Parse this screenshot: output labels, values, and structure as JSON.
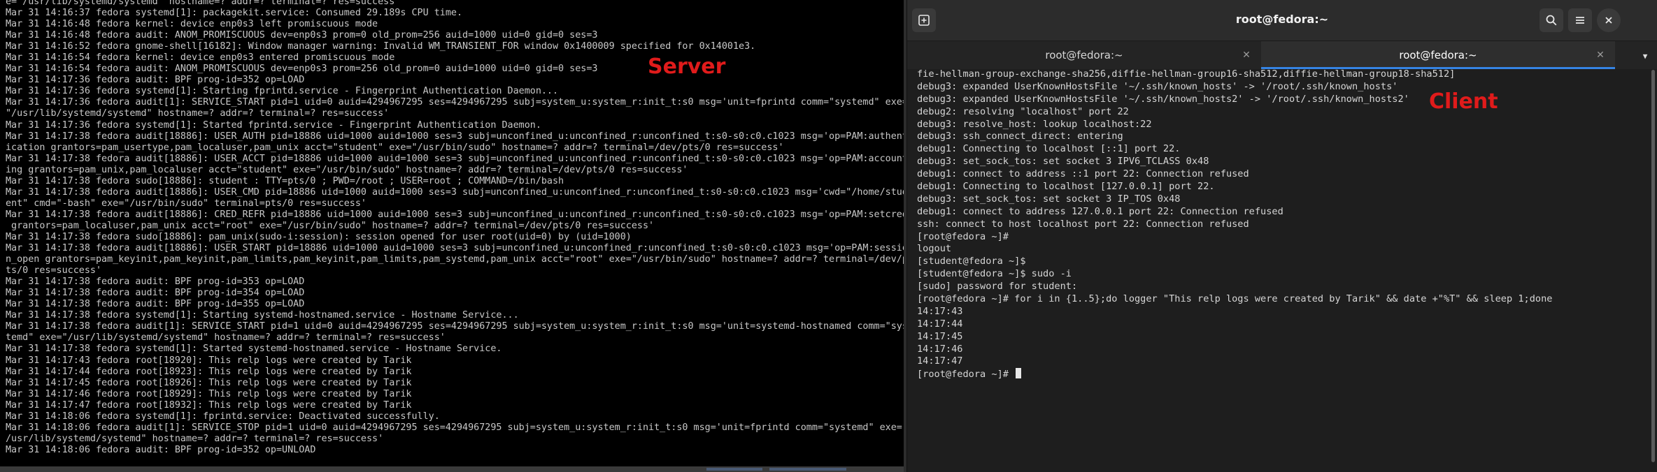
{
  "server": {
    "label": "Server",
    "log_lines": [
      "e=\"/usr/lib/systemd/systemd\" hostname=? addr=? terminal=? res=success'",
      "Mar 31 14:16:37 fedora systemd[1]: packagekit.service: Consumed 29.189s CPU time.",
      "Mar 31 14:16:48 fedora kernel: device enp0s3 left promiscuous mode",
      "Mar 31 14:16:48 fedora audit: ANOM_PROMISCUOUS dev=enp0s3 prom=0 old_prom=256 auid=1000 uid=0 gid=0 ses=3",
      "Mar 31 14:16:52 fedora gnome-shell[16182]: Window manager warning: Invalid WM_TRANSIENT_FOR window 0x1400009 specified for 0x14001e3.",
      "Mar 31 14:16:54 fedora kernel: device enp0s3 entered promiscuous mode",
      "Mar 31 14:16:54 fedora audit: ANOM_PROMISCUOUS dev=enp0s3 prom=256 old_prom=0 auid=1000 uid=0 gid=0 ses=3",
      "Mar 31 14:17:36 fedora audit: BPF prog-id=352 op=LOAD",
      "Mar 31 14:17:36 fedora systemd[1]: Starting fprintd.service - Fingerprint Authentication Daemon...",
      "Mar 31 14:17:36 fedora audit[1]: SERVICE_START pid=1 uid=0 auid=4294967295 ses=4294967295 subj=system_u:system_r:init_t:s0 msg='unit=fprintd comm=\"systemd\" exe=",
      "\"/usr/lib/systemd/systemd\" hostname=? addr=? terminal=? res=success'",
      "Mar 31 14:17:36 fedora systemd[1]: Started fprintd.service - Fingerprint Authentication Daemon.",
      "Mar 31 14:17:38 fedora audit[18886]: USER_AUTH pid=18886 uid=1000 auid=1000 ses=3 subj=unconfined_u:unconfined_r:unconfined_t:s0-s0:c0.c1023 msg='op=PAM:authent",
      "ication grantors=pam_usertype,pam_localuser,pam_unix acct=\"student\" exe=\"/usr/bin/sudo\" hostname=? addr=? terminal=/dev/pts/0 res=success'",
      "Mar 31 14:17:38 fedora audit[18886]: USER_ACCT pid=18886 uid=1000 auid=1000 ses=3 subj=unconfined_u:unconfined_r:unconfined_t:s0-s0:c0.c1023 msg='op=PAM:account",
      "ing grantors=pam_unix,pam_localuser acct=\"student\" exe=\"/usr/bin/sudo\" hostname=? addr=? terminal=/dev/pts/0 res=success'",
      "Mar 31 14:17:38 fedora sudo[18886]: student : TTY=pts/0 ; PWD=/root ; USER=root ; COMMAND=/bin/bash",
      "Mar 31 14:17:38 fedora audit[18886]: USER_CMD pid=18886 uid=1000 auid=1000 ses=3 subj=unconfined_u:unconfined_r:unconfined_t:s0-s0:c0.c1023 msg='cwd=\"/home/stud",
      "ent\" cmd=\"-bash\" exe=\"/usr/bin/sudo\" terminal=pts/0 res=success'",
      "Mar 31 14:17:38 fedora audit[18886]: CRED_REFR pid=18886 uid=1000 auid=1000 ses=3 subj=unconfined_u:unconfined_r:unconfined_t:s0-s0:c0.c1023 msg='op=PAM:setcred",
      " grantors=pam_localuser,pam_unix acct=\"root\" exe=\"/usr/bin/sudo\" hostname=? addr=? terminal=/dev/pts/0 res=success'",
      "Mar 31 14:17:38 fedora sudo[18886]: pam_unix(sudo-i:session): session opened for user root(uid=0) by (uid=1000)",
      "Mar 31 14:17:38 fedora audit[18886]: USER_START pid=18886 uid=1000 auid=1000 ses=3 subj=unconfined_u:unconfined_r:unconfined_t:s0-s0:c0.c1023 msg='op=PAM:sessio",
      "n_open grantors=pam_keyinit,pam_keyinit,pam_limits,pam_keyinit,pam_limits,pam_systemd,pam_unix acct=\"root\" exe=\"/usr/bin/sudo\" hostname=? addr=? terminal=/dev/p",
      "ts/0 res=success'",
      "Mar 31 14:17:38 fedora audit: BPF prog-id=353 op=LOAD",
      "Mar 31 14:17:38 fedora audit: BPF prog-id=354 op=LOAD",
      "Mar 31 14:17:38 fedora audit: BPF prog-id=355 op=LOAD",
      "Mar 31 14:17:38 fedora systemd[1]: Starting systemd-hostnamed.service - Hostname Service...",
      "Mar 31 14:17:38 fedora audit[1]: SERVICE_START pid=1 uid=0 auid=4294967295 ses=4294967295 subj=system_u:system_r:init_t:s0 msg='unit=systemd-hostnamed comm=\"sys",
      "temd\" exe=\"/usr/lib/systemd/systemd\" hostname=? addr=? terminal=? res=success'",
      "Mar 31 14:17:38 fedora systemd[1]: Started systemd-hostnamed.service - Hostname Service.",
      "Mar 31 14:17:43 fedora root[18920]: This relp logs were created by Tarik",
      "Mar 31 14:17:44 fedora root[18923]: This relp logs were created by Tarik",
      "Mar 31 14:17:45 fedora root[18926]: This relp logs were created by Tarik",
      "Mar 31 14:17:46 fedora root[18929]: This relp logs were created by Tarik",
      "Mar 31 14:17:47 fedora root[18932]: This relp logs were created by Tarik",
      "Mar 31 14:18:06 fedora systemd[1]: fprintd.service: Deactivated successfully.",
      "Mar 31 14:18:06 fedora audit[1]: SERVICE_STOP pid=1 uid=0 auid=4294967295 ses=4294967295 subj=system_u:system_r:init_t:s0 msg='unit=fprintd comm=\"systemd\" exe=\"",
      "/usr/lib/systemd/systemd\" hostname=? addr=? terminal=? res=success'",
      "Mar 31 14:18:06 fedora audit: BPF prog-id=352 op=UNLOAD"
    ]
  },
  "client": {
    "label": "Client",
    "window_title": "root@fedora:~",
    "tabs": [
      {
        "label": "root@fedora:~"
      },
      {
        "label": "root@fedora:~"
      }
    ],
    "output_lines": [
      "fie-hellman-group-exchange-sha256,diffie-hellman-group16-sha512,diffie-hellman-group18-sha512]",
      "debug3: expanded UserKnownHostsFile '~/.ssh/known_hosts' -> '/root/.ssh/known_hosts'",
      "debug3: expanded UserKnownHostsFile '~/.ssh/known_hosts2' -> '/root/.ssh/known_hosts2'",
      "debug2: resolving \"localhost\" port 22",
      "debug3: resolve_host: lookup localhost:22",
      "debug3: ssh_connect_direct: entering",
      "debug1: Connecting to localhost [::1] port 22.",
      "debug3: set_sock_tos: set socket 3 IPV6_TCLASS 0x48",
      "debug1: connect to address ::1 port 22: Connection refused",
      "debug1: Connecting to localhost [127.0.0.1] port 22.",
      "debug3: set_sock_tos: set socket 3 IP_TOS 0x48",
      "debug1: connect to address 127.0.0.1 port 22: Connection refused",
      "ssh: connect to host localhost port 22: Connection refused",
      "[root@fedora ~]#",
      "logout",
      "[student@fedora ~]$",
      "[student@fedora ~]$ sudo -i",
      "[sudo] password for student:",
      "[root@fedora ~]# for i in {1..5};do logger \"This relp logs were created by Tarik\" && date +\"%T\" && sleep 1;done",
      "14:17:43",
      "14:17:44",
      "14:17:45",
      "14:17:46",
      "14:17:47"
    ],
    "prompt": "[root@fedora ~]#"
  },
  "icons": {
    "new_tab": "new-tab-icon",
    "search": "search-icon",
    "menu": "hamburger-menu-icon",
    "close_window": "close-icon",
    "tab_close": "close-icon",
    "tab_overflow": "chevron-down-icon"
  },
  "colors": {
    "label_red": "#e01b1b",
    "active_tab_underline": "#3584e4",
    "server_bg": "#000000",
    "client_bg": "#1e1e1e"
  }
}
